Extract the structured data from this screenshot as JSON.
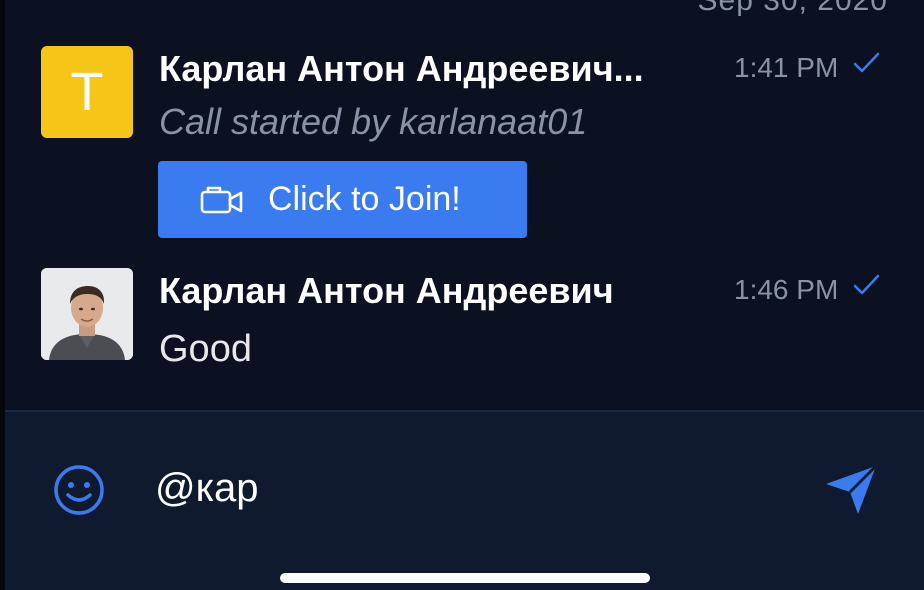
{
  "header": {
    "date_separator": "Sep 30, 2020"
  },
  "messages": [
    {
      "avatar_letter": "T",
      "author": "Карлан Антон Андреевич...",
      "time": "1:41 PM",
      "text": "Call started by karlanaat01",
      "action_label": "Click to Join!"
    },
    {
      "author": "Карлан Антон Андреевич",
      "time": "1:46 PM",
      "text": "Good"
    }
  ],
  "composer": {
    "value": "@кар"
  },
  "colors": {
    "background": "#0b1121",
    "accent": "#3a7bf0",
    "avatar_yellow": "#f5c518",
    "muted_text": "#8a93a6"
  },
  "icons": {
    "read_receipt": "check-icon",
    "video_call": "video-camera-icon",
    "emoji": "smiley-icon",
    "send": "send-icon"
  }
}
